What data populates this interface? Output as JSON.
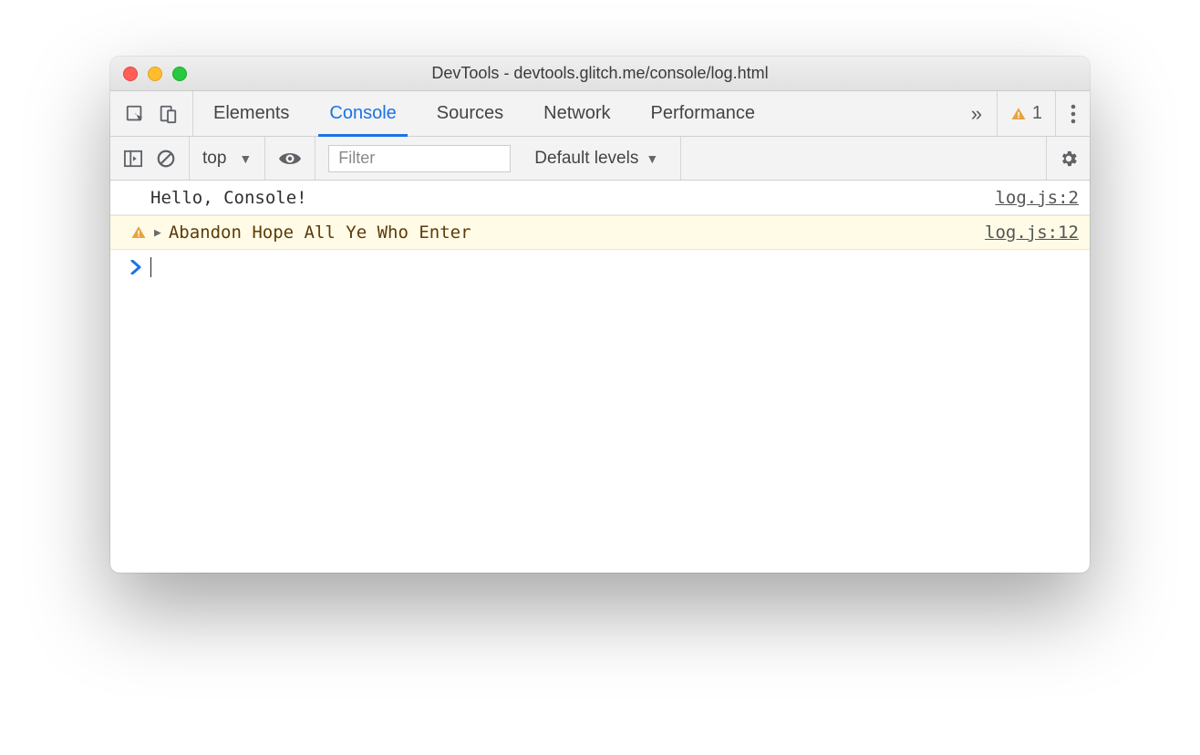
{
  "window": {
    "title": "DevTools - devtools.glitch.me/console/log.html"
  },
  "tabs": {
    "items": [
      "Elements",
      "Console",
      "Sources",
      "Network",
      "Performance"
    ],
    "active_index": 1,
    "overflow_glyph": "»"
  },
  "warnings": {
    "count": "1"
  },
  "console_toolbar": {
    "context": "top",
    "filter_placeholder": "Filter",
    "levels_label": "Default levels"
  },
  "messages": [
    {
      "kind": "log",
      "text": "Hello, Console!",
      "source": "log.js:2"
    },
    {
      "kind": "warn",
      "text": "Abandon Hope All Ye Who Enter",
      "source": "log.js:12"
    }
  ],
  "prompt": {
    "caret": "›"
  }
}
